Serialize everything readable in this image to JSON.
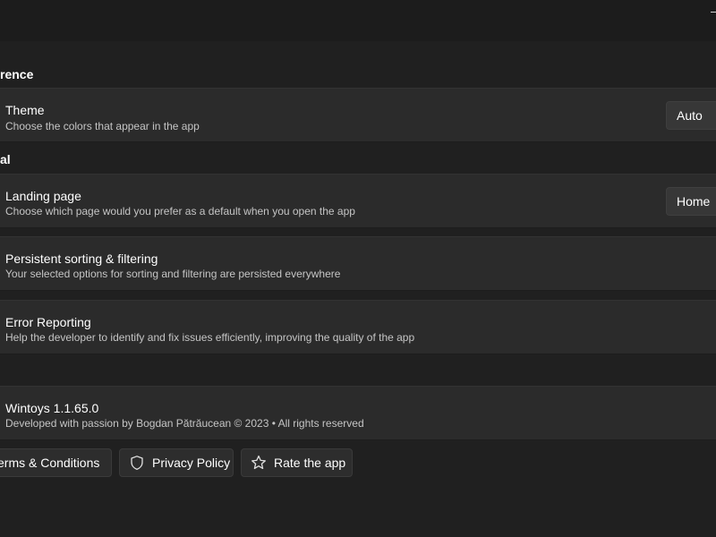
{
  "sections": {
    "appearance": {
      "header": "rence"
    },
    "general": {
      "header": "al"
    }
  },
  "theme": {
    "title": "Theme",
    "description": "Choose the colors that appear in the app",
    "value": "Auto"
  },
  "landing_page": {
    "title": "Landing page",
    "description": "Choose which page would you prefer as a default when you open the app",
    "value": "Home"
  },
  "persistent_sorting": {
    "title": "Persistent sorting & filtering",
    "description": "Your selected options for sorting and filtering are persisted everywhere"
  },
  "error_reporting": {
    "title": "Error Reporting",
    "description": "Help the developer to identify and fix issues efficiently, improving the quality of the app"
  },
  "about": {
    "title": "Wintoys 1.1.65.0",
    "description": "Developed with passion by Bogdan Pătrăucean © 2023 • All rights reserved"
  },
  "links": {
    "terms": "erms & Conditions",
    "privacy": "Privacy Policy",
    "rate": "Rate the app"
  },
  "icons": {
    "privacy": "shield-icon",
    "rate": "star-icon"
  }
}
